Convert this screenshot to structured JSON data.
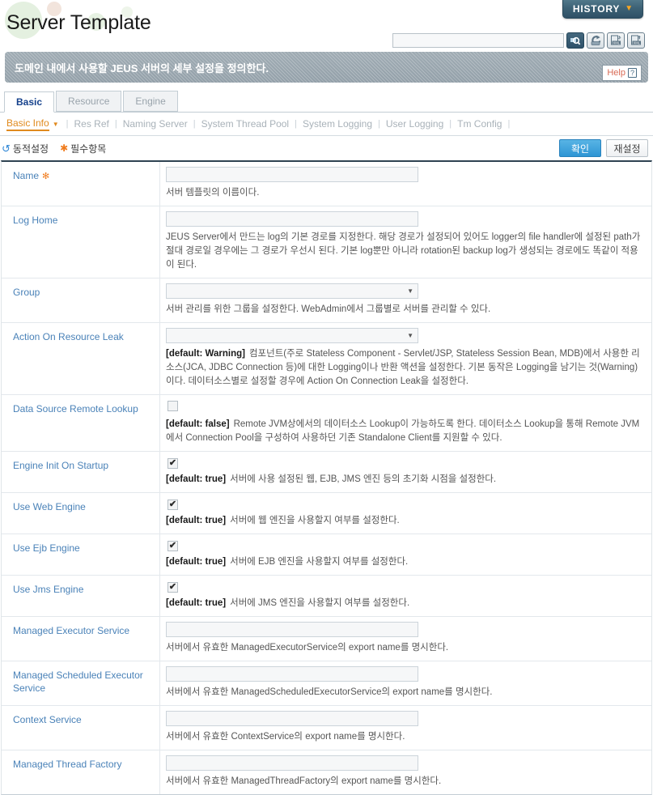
{
  "header": {
    "title": "Server Template",
    "history_button": "HISTORY",
    "history_caret_icon": "chevron-down-icon"
  },
  "toolbar": {
    "search_value": "",
    "search_placeholder": "",
    "icons": [
      {
        "name": "search-icon",
        "label": "Search"
      },
      {
        "name": "reload-icon",
        "label": "Reload"
      },
      {
        "name": "xml-import-icon",
        "label": "XML Import"
      },
      {
        "name": "xml-export-icon",
        "label": "XML Export"
      }
    ]
  },
  "banner": {
    "text": "도메인 내에서 사용할 JEUS 서버의 세부 설정을 정의한다.",
    "help_label": "Help",
    "help_icon": "question-mark-icon"
  },
  "tabs": [
    {
      "label": "Basic",
      "active": true
    },
    {
      "label": "Resource",
      "active": false
    },
    {
      "label": "Engine",
      "active": false
    }
  ],
  "subtabs": [
    {
      "label": "Basic Info",
      "active": true
    },
    {
      "label": "Res Ref",
      "active": false
    },
    {
      "label": "Naming Server",
      "active": false
    },
    {
      "label": "System Thread Pool",
      "active": false
    },
    {
      "label": "System Logging",
      "active": false
    },
    {
      "label": "User Logging",
      "active": false
    },
    {
      "label": "Tm Config",
      "active": false
    }
  ],
  "legend": {
    "dynamic_icon": "refresh-icon",
    "dynamic_label": "동적설정",
    "required_icon": "asterisk-icon",
    "required_label": "필수항목"
  },
  "actions": {
    "confirm_label": "확인",
    "reset_label": "재설정"
  },
  "colors": {
    "accent_orange": "#e08a1e",
    "label_blue": "#4a82b8",
    "primary_blue": "#2e95d4",
    "history_teal": "#3d6276",
    "required_star": "#f07c1e"
  },
  "form_rows": [
    {
      "label": "Name",
      "required": true,
      "control": "text",
      "value": "",
      "default": "",
      "desc": "서버 템플릿의 이름이다."
    },
    {
      "label": "Log Home",
      "required": false,
      "control": "text",
      "value": "",
      "default": "",
      "desc": "JEUS Server에서 만드는 log의 기본 경로를 지정한다. 해당 경로가 설정되어 있어도 logger의 file handler에 설정된 path가 절대 경로일 경우에는 그 경로가 우선시 된다. 기본 log뿐만 아니라 rotation된 backup log가 생성되는 경로에도 똑같이 적용이 된다."
    },
    {
      "label": "Group",
      "required": false,
      "control": "select",
      "value": "",
      "default": "",
      "desc": "서버 관리를 위한 그룹을 설정한다. WebAdmin에서 그룹별로 서버를 관리할 수 있다."
    },
    {
      "label": "Action On Resource Leak",
      "required": false,
      "control": "select",
      "value": "",
      "default": "[default: Warning]",
      "desc": "컴포넌트(주로 Stateless Component - Servlet/JSP, Stateless Session Bean, MDB)에서 사용한 리소스(JCA, JDBC Connection 등)에 대한 Logging이나 반환 액션을 설정한다. 기본 동작은 Logging을 남기는 것(Warning)이다. 데이터소스별로 설정할 경우에 Action On Connection Leak을 설정한다."
    },
    {
      "label": "Data Source Remote Lookup",
      "required": false,
      "control": "checkbox",
      "checked": false,
      "default": "[default: false]",
      "desc": "Remote JVM상에서의 데이터소스 Lookup이 가능하도록 한다. 데이터소스 Lookup을 통해 Remote JVM에서 Connection Pool을 구성하여 사용하던 기존 Standalone Client를 지원할 수 있다."
    },
    {
      "label": "Engine Init On Startup",
      "required": false,
      "control": "checkbox",
      "checked": true,
      "default": "[default: true]",
      "desc": "서버에 사용 설정된 웹, EJB, JMS 엔진 등의 초기화 시점을 설정한다."
    },
    {
      "label": "Use Web Engine",
      "required": false,
      "control": "checkbox",
      "checked": true,
      "default": "[default: true]",
      "desc": "서버에 웹 엔진을 사용할지 여부를 설정한다."
    },
    {
      "label": "Use Ejb Engine",
      "required": false,
      "control": "checkbox",
      "checked": true,
      "default": "[default: true]",
      "desc": "서버에 EJB 엔진을 사용할지 여부를 설정한다."
    },
    {
      "label": "Use Jms Engine",
      "required": false,
      "control": "checkbox",
      "checked": true,
      "default": "[default: true]",
      "desc": "서버에 JMS 엔진을 사용할지 여부를 설정한다."
    },
    {
      "label": "Managed Executor Service",
      "required": false,
      "control": "text",
      "value": "",
      "default": "",
      "desc": "서버에서 유효한 ManagedExecutorService의 export name를 명시한다."
    },
    {
      "label": "Managed Scheduled Executor Service",
      "required": false,
      "control": "text",
      "value": "",
      "default": "",
      "desc": "서버에서 유효한 ManagedScheduledExecutorService의 export name를 명시한다."
    },
    {
      "label": "Context Service",
      "required": false,
      "control": "text",
      "value": "",
      "default": "",
      "desc": "서버에서 유효한 ContextService의 export name를 명시한다."
    },
    {
      "label": "Managed Thread Factory",
      "required": false,
      "control": "text",
      "value": "",
      "default": "",
      "desc": "서버에서 유효한 ManagedThreadFactory의 export name를 명시한다."
    }
  ]
}
